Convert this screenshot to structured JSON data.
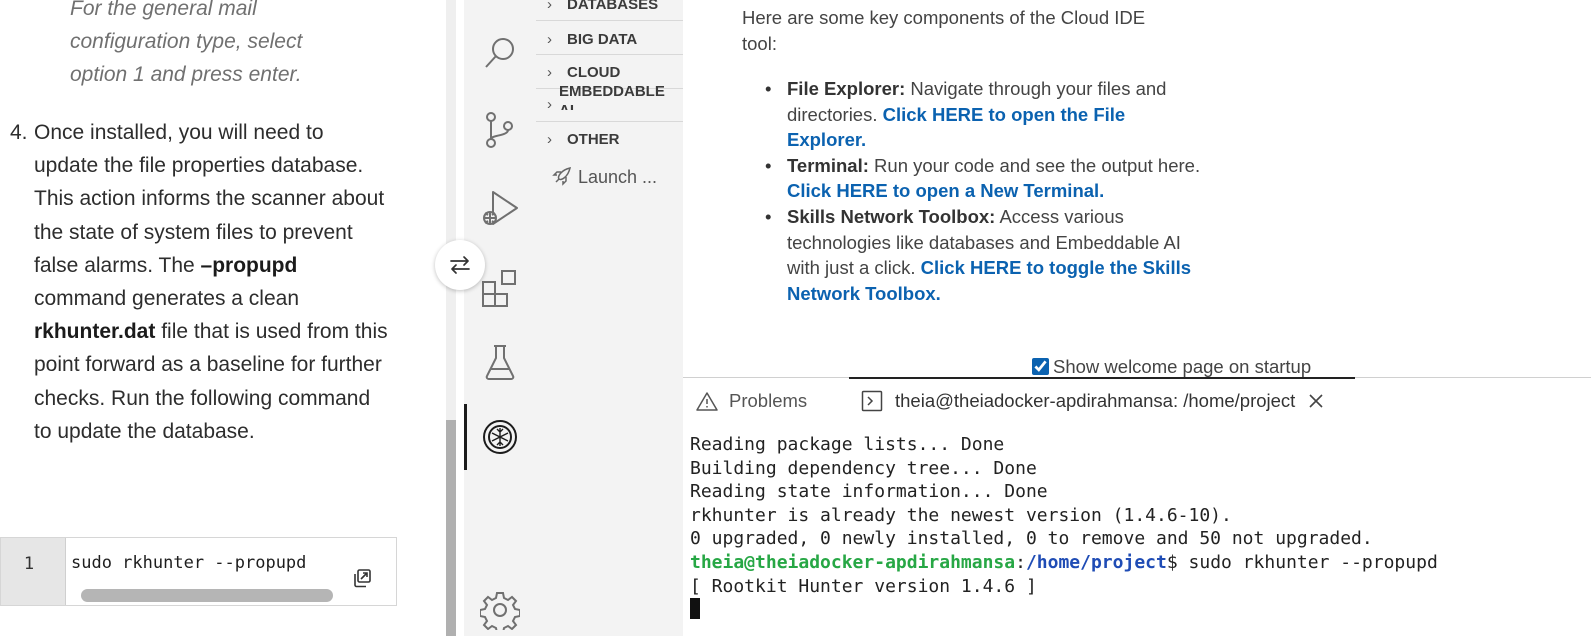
{
  "instructions": {
    "note_line1": "For the general mail",
    "note_line2": "configuration type, select",
    "note_line3": "option 1 and press enter.",
    "step_number": "4.",
    "step_text_1": "Once installed, you will need to update the file properties database. This action informs the scanner about the state of system files to prevent false alarms. The ",
    "step_bold_1": "–propupd",
    "step_text_2": " command generates a clean ",
    "step_bold_2": "rkhunter.dat",
    "step_text_3": " file that is used from this point forward as a baseline for further checks. Run the following command to update the database.",
    "code_line_number": "1",
    "code_command": "sudo rkhunter --propupd"
  },
  "activity_bar": {
    "icons": [
      "search-icon",
      "source-control-icon",
      "run-debug-icon",
      "extensions-icon",
      "lab-flask-icon",
      "skills-network-icon",
      "settings-gear-icon"
    ]
  },
  "side_panel": {
    "sections": [
      {
        "chevron": "›",
        "label": "DATABASES"
      },
      {
        "chevron": "›",
        "label": "BIG DATA"
      },
      {
        "chevron": "›",
        "label": "CLOUD"
      },
      {
        "chevron": "›",
        "label": "EMBEDDABLE AI"
      },
      {
        "chevron": "›",
        "label": "OTHER"
      }
    ],
    "launch_label": "Launch ..."
  },
  "welcome": {
    "intro": "Here are some key components of the Cloud IDE tool:",
    "items": [
      {
        "title": "File Explorer:",
        "text": " Navigate through your files and directories. ",
        "link": "Click HERE to open the File Explorer."
      },
      {
        "title": "Terminal:",
        "text": " Run your code and see the output here. ",
        "link": "Click HERE to open a New Terminal."
      },
      {
        "title": "Skills Network Toolbox:",
        "text": " Access various technologies like databases and Embeddable AI with just a click. ",
        "link": "Click HERE to toggle the Skills Network Toolbox."
      }
    ],
    "show_on_startup_label": "Show welcome page on startup",
    "show_on_startup_checked": true
  },
  "panel": {
    "problems_tab": "Problems",
    "terminal_tab": "theia@theiadocker-apdirahmansa: /home/project",
    "terminal_lines": [
      "Reading package lists... Done",
      "Building dependency tree... Done",
      "Reading state information... Done",
      "rkhunter is already the newest version (1.4.6-10).",
      "0 upgraded, 0 newly installed, 0 to remove and 50 not upgraded."
    ],
    "prompt_user": "theia@theiadocker-apdirahmansa",
    "prompt_sep": ":",
    "prompt_path": "/home/project",
    "prompt_symbol": "$ ",
    "prompt_command": "sudo rkhunter --propupd",
    "output_line": "[ Rootkit Hunter version 1.4.6 ]"
  },
  "colors": {
    "link": "#0b62b0",
    "prompt_user": "#27a745",
    "prompt_path": "#1f4cb5"
  }
}
